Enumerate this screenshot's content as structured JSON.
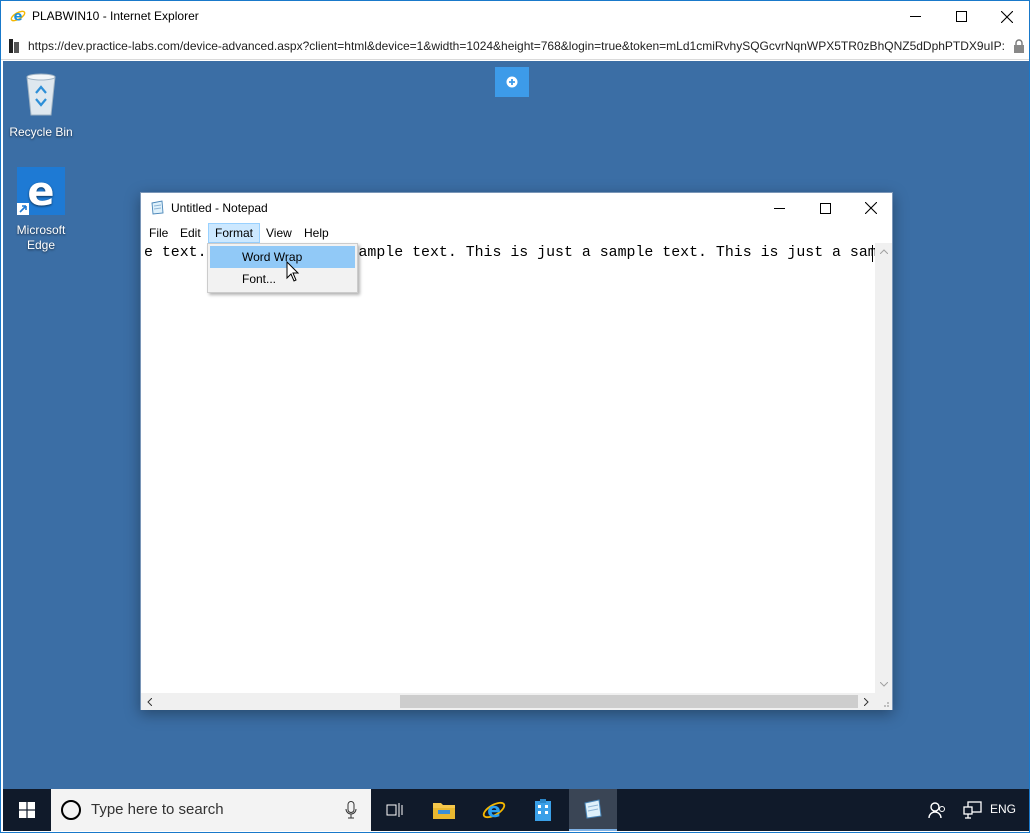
{
  "ie": {
    "title": "PLABWIN10 - Internet Explorer",
    "url": "https://dev.practice-labs.com/device-advanced.aspx?client=html&device=1&width=1024&height=768&login=true&token=mLd1cmiRvhySQGcvrNqnWPX5TR0zBhQNZ5dDphPTDX9uIP:"
  },
  "desktop": {
    "icons": [
      {
        "label": "Recycle Bin"
      },
      {
        "label": "Microsoft Edge"
      }
    ]
  },
  "notepad": {
    "title": "Untitled - Notepad",
    "menu": [
      "File",
      "Edit",
      "Format",
      "View",
      "Help"
    ],
    "text": "e text. This is just a sample text. This is just a sample text. This is just a sample text."
  },
  "format_menu": {
    "items": [
      "Word Wrap",
      "Font..."
    ]
  },
  "taskbar": {
    "search_placeholder": "Type here to search",
    "language": "ENG"
  },
  "colors": {
    "desktop": "#3b6ea5",
    "taskbar": "#101a2a",
    "menu_highlight": "#91c9f7",
    "menu_open": "#cce8ff"
  }
}
